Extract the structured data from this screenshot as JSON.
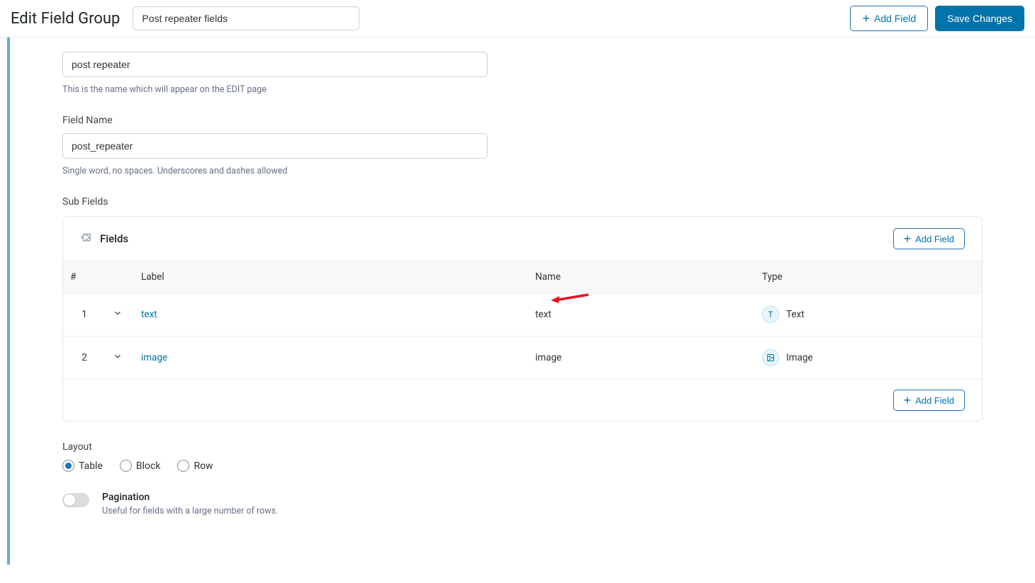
{
  "header": {
    "page_title": "Edit Field Group",
    "title_input_value": "Post repeater fields",
    "add_field_label": "Add Field",
    "save_label": "Save Changes"
  },
  "field_label": {
    "value": "post repeater",
    "help": "This is the name which will appear on the EDIT page"
  },
  "field_name": {
    "label": "Field Name",
    "value": "post_repeater",
    "help": "Single word, no spaces. Underscores and dashes allowed"
  },
  "subfields": {
    "section_label": "Sub Fields",
    "box_title": "Fields",
    "add_field_label": "Add Field",
    "columns": {
      "num": "#",
      "label": "Label",
      "name": "Name",
      "type": "Type"
    },
    "rows": [
      {
        "num": "1",
        "label": "text",
        "name": "text",
        "type": "Text",
        "icon": "T"
      },
      {
        "num": "2",
        "label": "image",
        "name": "image",
        "type": "Image",
        "icon": "img"
      }
    ]
  },
  "layout": {
    "label": "Layout",
    "options": [
      "Table",
      "Block",
      "Row"
    ],
    "selected": "Table"
  },
  "pagination": {
    "label": "Pagination",
    "help": "Useful for fields with a large number of rows."
  }
}
